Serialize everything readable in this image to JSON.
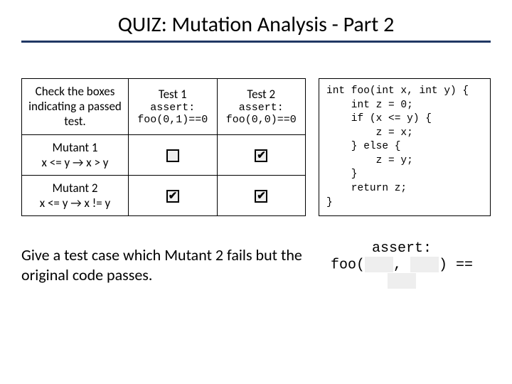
{
  "title": "QUIZ: Mutation Analysis - Part 2",
  "table": {
    "header_instruction": "Check the boxes indicating a passed test.",
    "col1_title": "Test 1",
    "col1_sub": "assert:\nfoo(0,1)==0",
    "col2_title": "Test 2",
    "col2_sub": "assert:\nfoo(0,0)==0",
    "row1_mutant": "Mutant 1",
    "row1_change": "x <= y  →  x > y",
    "row2_mutant": "Mutant 2",
    "row2_change": "x <= y  → x != y",
    "checks": {
      "m1_t1": false,
      "m1_t2": true,
      "m2_t1": true,
      "m2_t2": true
    }
  },
  "code": "int foo(int x, int y) {\n    int z = 0;\n    if (x <= y) {\n        z = x;\n    } else {\n        z = y;\n    }\n    return z;\n}",
  "bottom_prompt": "Give a test case which Mutant 2 fails but the original code passes.",
  "assert": {
    "label": "assert:",
    "prefix": "foo(",
    "comma": ",",
    "suffix": ") =="
  }
}
